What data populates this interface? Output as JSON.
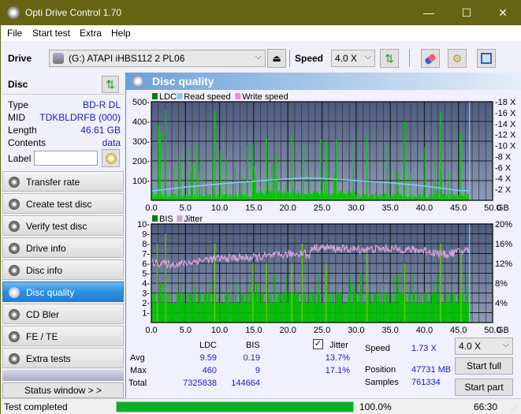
{
  "window": {
    "title": "Opti Drive Control 1.70",
    "minimize": "—",
    "maximize": "☐",
    "close": "✕"
  },
  "menu": [
    "File",
    "Start test",
    "Extra",
    "Help"
  ],
  "toolbar": {
    "drive_label": "Drive",
    "drive_value": "(G:)   ATAPI iHBS112   2 PL06",
    "speed_label": "Speed",
    "speed_value": "4.0 X"
  },
  "disc": {
    "header": "Disc",
    "fields": [
      {
        "key": "Type",
        "value": "BD-R DL"
      },
      {
        "key": "MID",
        "value": "TDKBLDRFB (000)"
      },
      {
        "key": "Length",
        "value": "46.61 GB"
      },
      {
        "key": "Contents",
        "value": "data"
      }
    ],
    "label_key": "Label",
    "label_value": ""
  },
  "nav": [
    {
      "label": "Transfer rate",
      "active": false
    },
    {
      "label": "Create test disc",
      "active": false
    },
    {
      "label": "Verify test disc",
      "active": false
    },
    {
      "label": "Drive info",
      "active": false
    },
    {
      "label": "Disc info",
      "active": false
    },
    {
      "label": "Disc quality",
      "active": true
    },
    {
      "label": "CD Bler",
      "active": false
    },
    {
      "label": "FE / TE",
      "active": false
    },
    {
      "label": "Extra tests",
      "active": false
    }
  ],
  "status_window_label": "Status window > >",
  "panel_title": "Disc quality",
  "chart_data": [
    {
      "type": "bar",
      "title": "LDC",
      "legend": [
        {
          "name": "LDC",
          "color": "#008000"
        },
        {
          "name": "Read speed",
          "color": "#88ccf8"
        },
        {
          "name": "Write speed",
          "color": "#f088e0"
        }
      ],
      "xlabel": "GB",
      "x_ticks": [
        "0.0",
        "5.0",
        "10.0",
        "15.0",
        "20.0",
        "25.0",
        "30.0",
        "35.0",
        "40.0",
        "45.0",
        "50.0"
      ],
      "xlim": [
        0,
        50
      ],
      "y_ticks": [
        "100",
        "200",
        "300",
        "400",
        "500"
      ],
      "ylim": [
        0,
        500
      ],
      "y2_ticks": [
        "2 X",
        "4 X",
        "6 X",
        "8 X",
        "10 X",
        "12 X",
        "14 X",
        "16 X",
        "18 X"
      ],
      "y2lim": [
        0,
        18
      ],
      "data_end_gb": 46.61,
      "ldc_baseline_approx": 25,
      "ldc_peaks": [
        [
          1.0,
          380
        ],
        [
          1.2,
          350
        ],
        [
          2.0,
          460
        ],
        [
          4.0,
          230
        ],
        [
          5.2,
          270
        ],
        [
          6.6,
          285
        ],
        [
          9.2,
          455
        ],
        [
          10.0,
          250
        ],
        [
          14.0,
          275
        ],
        [
          14.8,
          285
        ],
        [
          16.8,
          320
        ],
        [
          18.2,
          230
        ],
        [
          20.5,
          330
        ],
        [
          22.2,
          285
        ],
        [
          24.8,
          310
        ],
        [
          25.6,
          300
        ],
        [
          27.0,
          305
        ],
        [
          29.5,
          275
        ],
        [
          31.5,
          330
        ],
        [
          34.5,
          280
        ],
        [
          37.0,
          400
        ],
        [
          40.0,
          270
        ],
        [
          42.3,
          450
        ],
        [
          45.2,
          340
        ]
      ],
      "read_speed": [
        [
          0,
          1.7
        ],
        [
          5,
          2.4
        ],
        [
          10,
          3.0
        ],
        [
          15,
          3.5
        ],
        [
          20,
          3.9
        ],
        [
          23,
          4.1
        ],
        [
          25,
          4.0
        ],
        [
          30,
          3.6
        ],
        [
          35,
          3.2
        ],
        [
          40,
          2.6
        ],
        [
          45,
          1.8
        ],
        [
          46.61,
          1.73
        ]
      ]
    },
    {
      "type": "bar",
      "title": "BIS",
      "legend": [
        {
          "name": "BIS",
          "color": "#008000"
        },
        {
          "name": "Jitter",
          "color": "#d8a0d8"
        }
      ],
      "xlabel": "GB",
      "x_ticks": [
        "0.0",
        "5.0",
        "10.0",
        "15.0",
        "20.0",
        "25.0",
        "30.0",
        "35.0",
        "40.0",
        "45.0",
        "50.0"
      ],
      "xlim": [
        0,
        50
      ],
      "y_ticks": [
        "1",
        "2",
        "3",
        "4",
        "5",
        "6",
        "7",
        "8",
        "9",
        "10"
      ],
      "ylim": [
        0,
        10
      ],
      "y2_ticks": [
        "4%",
        "8%",
        "12%",
        "16%",
        "20%"
      ],
      "y2lim": [
        0,
        20
      ],
      "data_end_gb": 46.61,
      "bis_peaks": [
        [
          0.8,
          8
        ],
        [
          2.0,
          9
        ],
        [
          9.2,
          8
        ],
        [
          14.8,
          6
        ],
        [
          16.8,
          6
        ],
        [
          20.5,
          6
        ],
        [
          22.0,
          8
        ],
        [
          25.5,
          6
        ],
        [
          31.5,
          7
        ],
        [
          37.0,
          6
        ],
        [
          42.3,
          8
        ],
        [
          45.3,
          7
        ]
      ],
      "jitter": [
        [
          0,
          12.2
        ],
        [
          3,
          11.8
        ],
        [
          5,
          12.0
        ],
        [
          7,
          12.6
        ],
        [
          10,
          13.0
        ],
        [
          15,
          13.2
        ],
        [
          20,
          13.8
        ],
        [
          22.5,
          14.2
        ],
        [
          23.0,
          13.0
        ],
        [
          23.5,
          15.2
        ],
        [
          25,
          15.2
        ],
        [
          30,
          14.8
        ],
        [
          35,
          15.0
        ],
        [
          40,
          14.6
        ],
        [
          43,
          13.8
        ],
        [
          46.61,
          14.8
        ]
      ]
    }
  ],
  "stats": {
    "headers": {
      "ldc": "LDC",
      "bis": "BIS",
      "jitter": "Jitter"
    },
    "jitter_checked": true,
    "rows": [
      {
        "label": "Avg",
        "ldc": "9.59",
        "bis": "0.19",
        "jitter": "13.7%"
      },
      {
        "label": "Max",
        "ldc": "460",
        "bis": "9",
        "jitter": "17.1%"
      },
      {
        "label": "Total",
        "ldc": "7325838",
        "bis": "144664",
        "jitter": ""
      }
    ],
    "speed_label": "Speed",
    "speed_value": "1.73 X",
    "position_label": "Position",
    "position_value": "47731 MB",
    "samples_label": "Samples",
    "samples_value": "761334",
    "speed_select": "4.0 X",
    "start_full": "Start full",
    "start_part": "Start part"
  },
  "statusbar": {
    "text": "Test completed",
    "progress_percent": 100,
    "progress_text": "100.0%",
    "time": "66:30"
  }
}
